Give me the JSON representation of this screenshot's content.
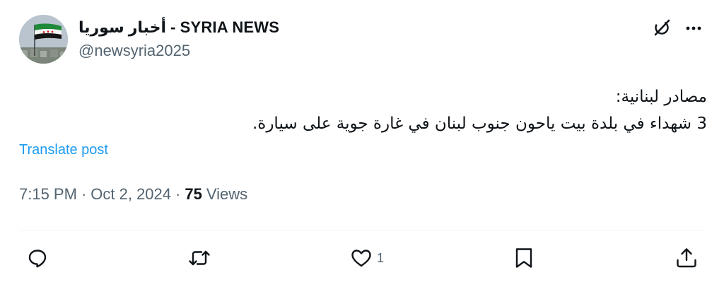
{
  "post": {
    "author": {
      "display_name": "أخبار سوريا - SYRIA NEWS",
      "handle": "@newsyria2025",
      "avatar": "syrian-revolution-flag-over-city"
    },
    "body_lines": [
      "مصادر لبنانية:",
      "3 شهداء في بلدة بيت ياحون جنوب لبنان في غارة جوية على سيارة."
    ],
    "translate_label": "Translate post",
    "time": "7:15 PM",
    "date": "Oct 2, 2024",
    "separator": "·",
    "views_count": "75",
    "views_label": "Views"
  },
  "actions": {
    "reply": {
      "icon": "reply-icon"
    },
    "repost": {
      "icon": "repost-icon"
    },
    "like": {
      "icon": "heart-icon",
      "count": "1"
    },
    "bookmark": {
      "icon": "bookmark-icon"
    },
    "share": {
      "icon": "share-icon"
    }
  },
  "header_icons": [
    "grok-icon",
    "more-icon"
  ],
  "colors": {
    "text": "#0f1419",
    "secondary": "#536471",
    "link": "#1d9bf0",
    "divider": "#eff3f4"
  }
}
